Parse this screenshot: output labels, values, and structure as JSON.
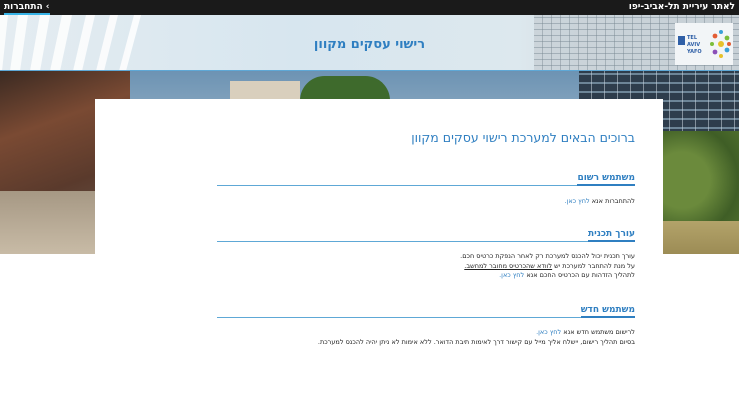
{
  "topbar": {
    "login_label": "התחברות ‹",
    "site_link": "לאתר עיריית תל-אביב-יפו"
  },
  "header": {
    "title": "רישוי עסקים מקוון",
    "logo_text": "TEL AVIV YAFO"
  },
  "main": {
    "title": "ברוכים הבאים למערכת רישוי עסקים מקוון",
    "sections": [
      {
        "heading": "משתמש רשום",
        "line1_text": "להתחברות אנא ",
        "line1_link": "לחץ כאן."
      },
      {
        "heading": "עורך תכנית",
        "line1": "עורך תכנית יכול להכנס למערכת רק לאחר הנפקת כרטיס חכם.",
        "line2_text": "על מנת להתחבר למערכת יש ",
        "line2_link": "לוודא שהכרטיס מחובר למחשב.",
        "line3_text": "לתהליך הזדהות עם הכרטיס החכם אנא ",
        "line3_link": "לחץ כאן."
      },
      {
        "heading": "משתמש חדש",
        "line1_text": "לרישום משתמש חדש אנא ",
        "line1_link": "לחץ כאן.",
        "line2": "בסיום תהליך רישום, יישלח אליך מייל עם קישור דרך לאימות תיבת הדואר. ללא אימות לא ניתן יהיה להכנס למערכת."
      }
    ]
  },
  "colors": {
    "accent": "#2f7fc1",
    "rule": "#5ea8d6",
    "topbar": "#1a1a1a"
  }
}
